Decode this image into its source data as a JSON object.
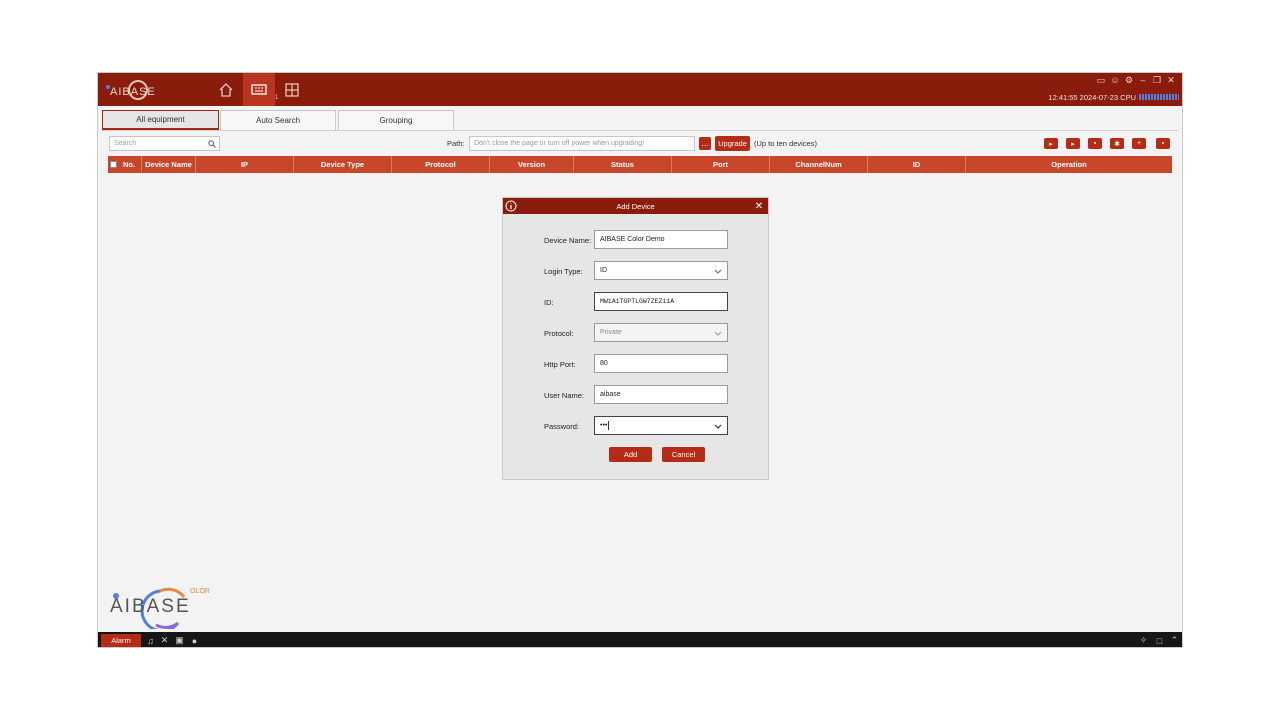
{
  "app": {
    "logo_text": "AIBASE",
    "logo_sub": "OLOR",
    "clock": "12:41:55 2024-07-23",
    "cpu_label": "CPU",
    "nav_badge": "1"
  },
  "tabs": [
    {
      "label": "All equipment",
      "active": true
    },
    {
      "label": "Auto Search",
      "active": false
    },
    {
      "label": "Grouping",
      "active": false
    }
  ],
  "toolbar": {
    "search_placeholder": "Search",
    "path_label": "Path:",
    "path_placeholder": "Don't close the page or turn off power when upgrading!",
    "browse_label": "...",
    "upgrade_label": "Upgrade",
    "upgrade_note": "(Up to ten devices)"
  },
  "table": {
    "columns": [
      "No.",
      "Device Name",
      "IP",
      "Device Type",
      "Protocol",
      "Version",
      "Status",
      "Port",
      "ChannelNum",
      "ID",
      "Operation"
    ]
  },
  "dialog": {
    "title": "Add Device",
    "fields": {
      "device_name": {
        "label": "Device Name:",
        "value": "AIBASE Color Demo"
      },
      "login_type": {
        "label": "Login Type:",
        "value": "ID"
      },
      "id": {
        "label": "ID:",
        "value": "MW1A1TGPTLGW7ZEZ11A"
      },
      "protocol": {
        "label": "Protocol:",
        "value": "Private"
      },
      "http_port": {
        "label": "Http Port:",
        "value": "80"
      },
      "user_name": {
        "label": "User Name:",
        "value": "aibase"
      },
      "password": {
        "label": "Password:",
        "value": "•••"
      }
    },
    "add_label": "Add",
    "cancel_label": "Cancel"
  },
  "statusbar": {
    "alarm_label": "Alarm"
  },
  "colors": {
    "titlebar": "#8a1c0c",
    "accent": "#b52b15",
    "table_header": "#c8472b"
  }
}
